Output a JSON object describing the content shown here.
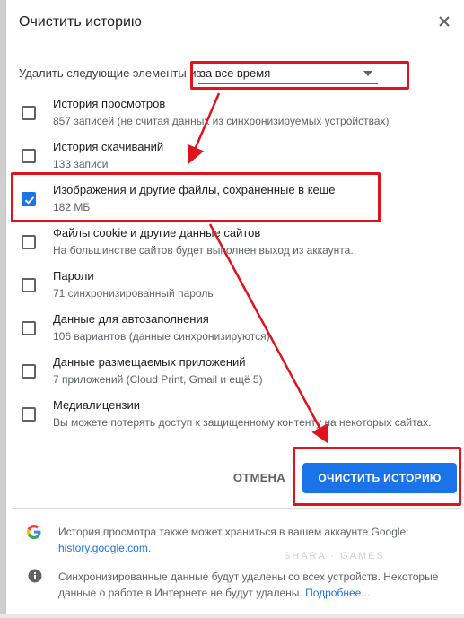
{
  "dialog": {
    "title": "Очистить историю",
    "range_label": "Удалить следующие элементы из",
    "range_value": "за все время",
    "items": [
      {
        "label": "История просмотров",
        "sub": "857 записей (не считая данных из синхронизируемых устройствах)",
        "checked": false
      },
      {
        "label": "История скачиваний",
        "sub": "133 записи",
        "checked": false
      },
      {
        "label": "Изображения и другие файлы, сохраненные в кеше",
        "sub": "182 МБ",
        "checked": true
      },
      {
        "label": "Файлы cookie и другие данные сайтов",
        "sub": "На большинстве сайтов будет выполнен выход из аккаунта.",
        "checked": false
      },
      {
        "label": "Пароли",
        "sub": "71 синхронизированный пароль",
        "checked": false
      },
      {
        "label": "Данные для автозаполнения",
        "sub": "106 вариантов (данные синхронизируются)",
        "checked": false
      },
      {
        "label": "Данные размещаемых приложений",
        "sub": "7 приложений (Cloud Print, Gmail и ещё 5)",
        "checked": false
      },
      {
        "label": "Медиалицензии",
        "sub": "Вы можете потерять доступ к защищенному контенту на некоторых сайтах.",
        "checked": false
      }
    ],
    "cancel_label": "ОТМЕНА",
    "clear_label": "ОЧИСТИТЬ ИСТОРИЮ"
  },
  "footer": {
    "google_text": "История просмотра также может храниться в вашем аккаунте Google:",
    "google_link": "history.google.com.",
    "sync_text": "Синхронизированные данные будут удалены со всех устройств. Некоторые данные о работе в Интернете не будут удалены.",
    "sync_link": "Подробнее..."
  },
  "colors": {
    "accent": "#1a73e8",
    "highlight": "#e0121b"
  },
  "icons": {
    "close": "close-icon",
    "dropdown": "chevron-down-icon",
    "google": "google-g-icon",
    "info": "info-icon"
  }
}
